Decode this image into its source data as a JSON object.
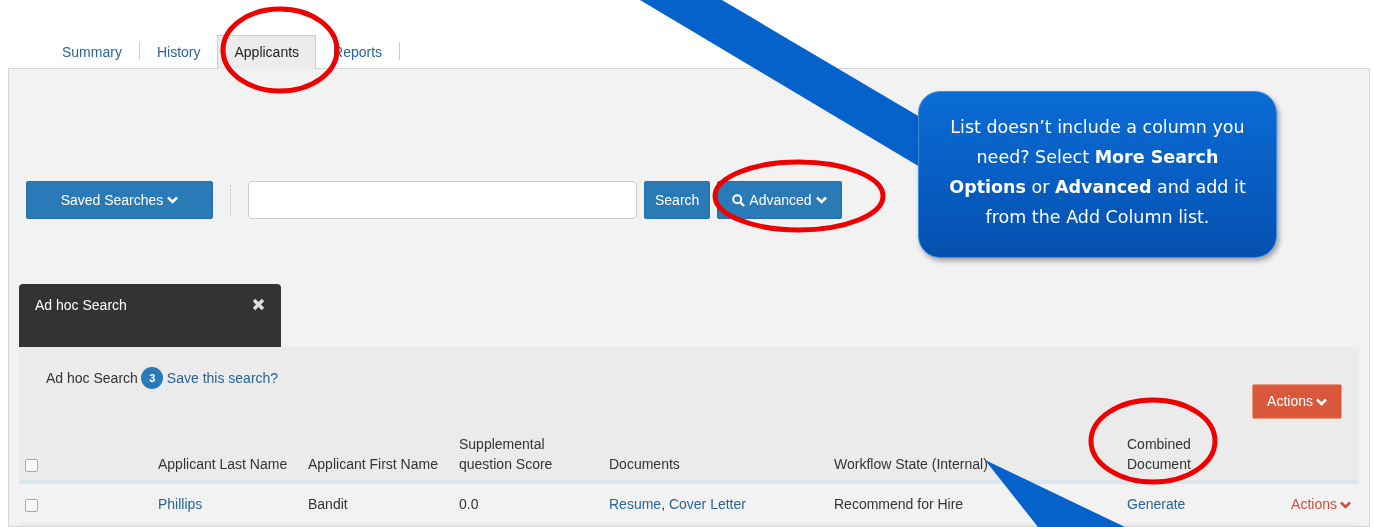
{
  "tabs": [
    {
      "label": "Summary",
      "selected": false
    },
    {
      "label": "History",
      "selected": false
    },
    {
      "label": "Applicants",
      "selected": true
    },
    {
      "label": "Reports",
      "selected": false
    }
  ],
  "toolbar": {
    "saved_searches_button": "Saved Searches",
    "search_button": "Search",
    "advanced_button": "Advanced"
  },
  "search_tab": {
    "label": "Ad hoc Search"
  },
  "results": {
    "search_name": "Ad hoc Search",
    "count": "3",
    "save_link": "Save this search?",
    "actions_button": "Actions"
  },
  "table": {
    "select_all_checked": false,
    "columns": [
      "Applicant Last Name",
      "Applicant First Name",
      "Supplemental question Score",
      "Documents",
      "Workflow State (Internal)",
      "Combined Document"
    ],
    "rows": [
      {
        "checked": false,
        "last_name": "Phillips",
        "first_name": "Bandit",
        "score": "0.0",
        "documents": [
          "Resume",
          "Cover Letter"
        ],
        "documents_separator": ",",
        "workflow_state": "Recommend for Hire",
        "combined_document": "Generate",
        "actions": "Actions"
      }
    ]
  },
  "callout": {
    "text": "List doesn’t include a column you need? Select **More Search Options** or **Advanced** and add it from the Add Column list."
  }
}
